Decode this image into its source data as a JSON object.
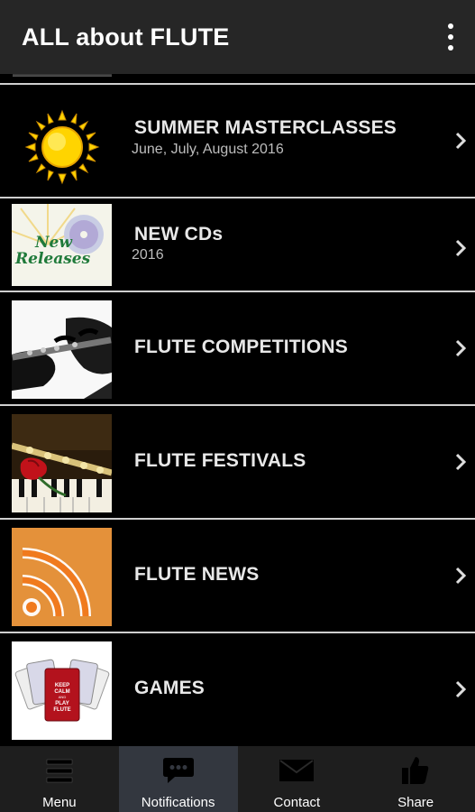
{
  "app": {
    "title": "ALL about FLUTE"
  },
  "list": {
    "items": [
      {
        "label": "SUMMER MASTERCLASSES",
        "subtitle": "June, July, August 2016",
        "icon": "sun-icon"
      },
      {
        "label": "NEW CDs",
        "subtitle": "2016",
        "icon": "new-releases-icon",
        "image_text": "New Releases"
      },
      {
        "label": "FLUTE COMPETITIONS",
        "subtitle": "",
        "icon": "flute-hands-icon"
      },
      {
        "label": "FLUTE FESTIVALS",
        "subtitle": "",
        "icon": "flute-rose-piano-icon"
      },
      {
        "label": "FLUTE NEWS",
        "subtitle": "",
        "icon": "rss-icon"
      },
      {
        "label": "GAMES",
        "subtitle": "",
        "icon": "keep-calm-cards-icon",
        "image_text": "KEEP CALM AND PLAY FLUTE"
      }
    ]
  },
  "bottom_nav": {
    "tabs": [
      {
        "label": "Menu",
        "icon": "hamburger-icon",
        "active": false
      },
      {
        "label": "Notifications",
        "icon": "chat-bubble-icon",
        "active": true
      },
      {
        "label": "Contact",
        "icon": "envelope-icon",
        "active": false
      },
      {
        "label": "Share",
        "icon": "thumbs-up-icon",
        "active": false
      }
    ]
  },
  "colors": {
    "appbar": "#262626",
    "background": "#000000",
    "separator": "#cfcfcf",
    "bottom_nav": "#1e1e1e",
    "active_tab": "#33373f",
    "sun_yellow": "#ffd400",
    "rss_orange": "#f07a1e"
  }
}
